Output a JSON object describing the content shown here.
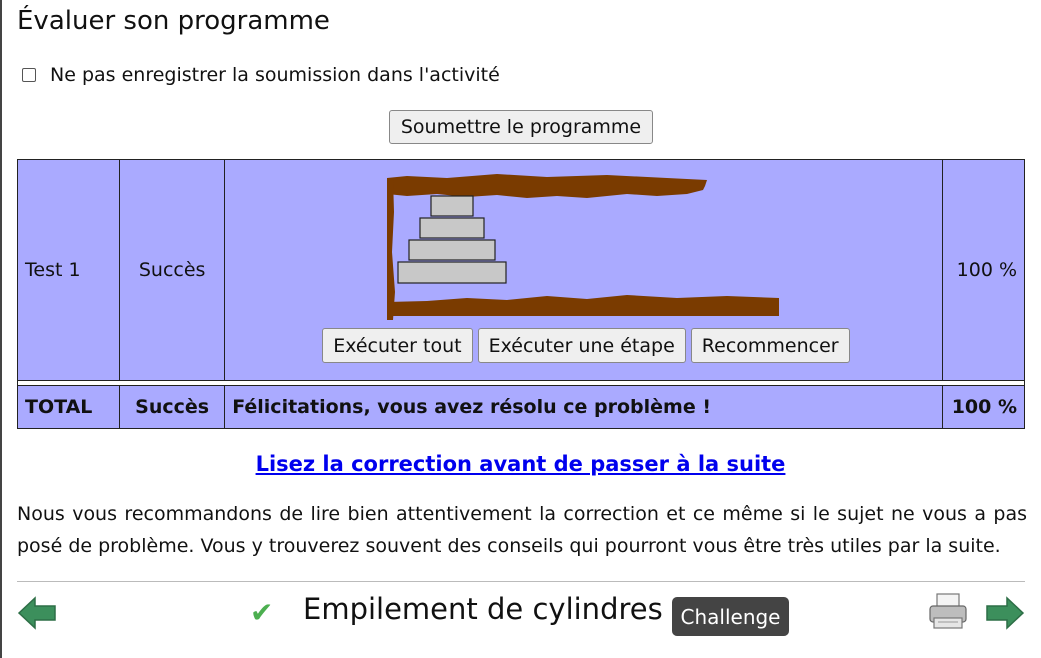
{
  "header": {
    "title": "Évaluer son programme"
  },
  "options": {
    "no_save_label": "Ne pas enregistrer la soumission dans l'activité",
    "no_save_checked": false
  },
  "actions": {
    "submit_label": "Soumettre le programme"
  },
  "results": {
    "rows": [
      {
        "test": "Test 1",
        "result": "Succès",
        "score": "100 %"
      }
    ],
    "runner": {
      "run_all_label": "Exécuter tout",
      "step_label": "Exécuter une étape",
      "restart_label": "Recommencer"
    },
    "total": {
      "label": "TOTAL",
      "result": "Succès",
      "message": "Félicitations, vous avez résolu ce problème !",
      "score": "100 %"
    }
  },
  "correction": {
    "link_text": "Lisez la correction avant de passer à la suite",
    "paragraph": "Nous vous recommandons de lire bien attentivement la correction et ce même si le sujet ne vous a pas posé de problème. Vous y trouverez souvent des conseils qui pourront vous être très utiles par la suite."
  },
  "footer": {
    "task_title": "Empilement de cylindres",
    "badge": "Challenge",
    "status_icon": "check-icon",
    "prev_icon": "arrow-left-icon",
    "next_icon": "arrow-right-icon",
    "print_icon": "printer-icon"
  },
  "colors": {
    "table_bg": "#aaaaff",
    "link": "#0000ee",
    "check": "#4caf50",
    "arrow": "#3c8f5c",
    "badge_bg": "#444444",
    "earth": "#7a3b00"
  }
}
